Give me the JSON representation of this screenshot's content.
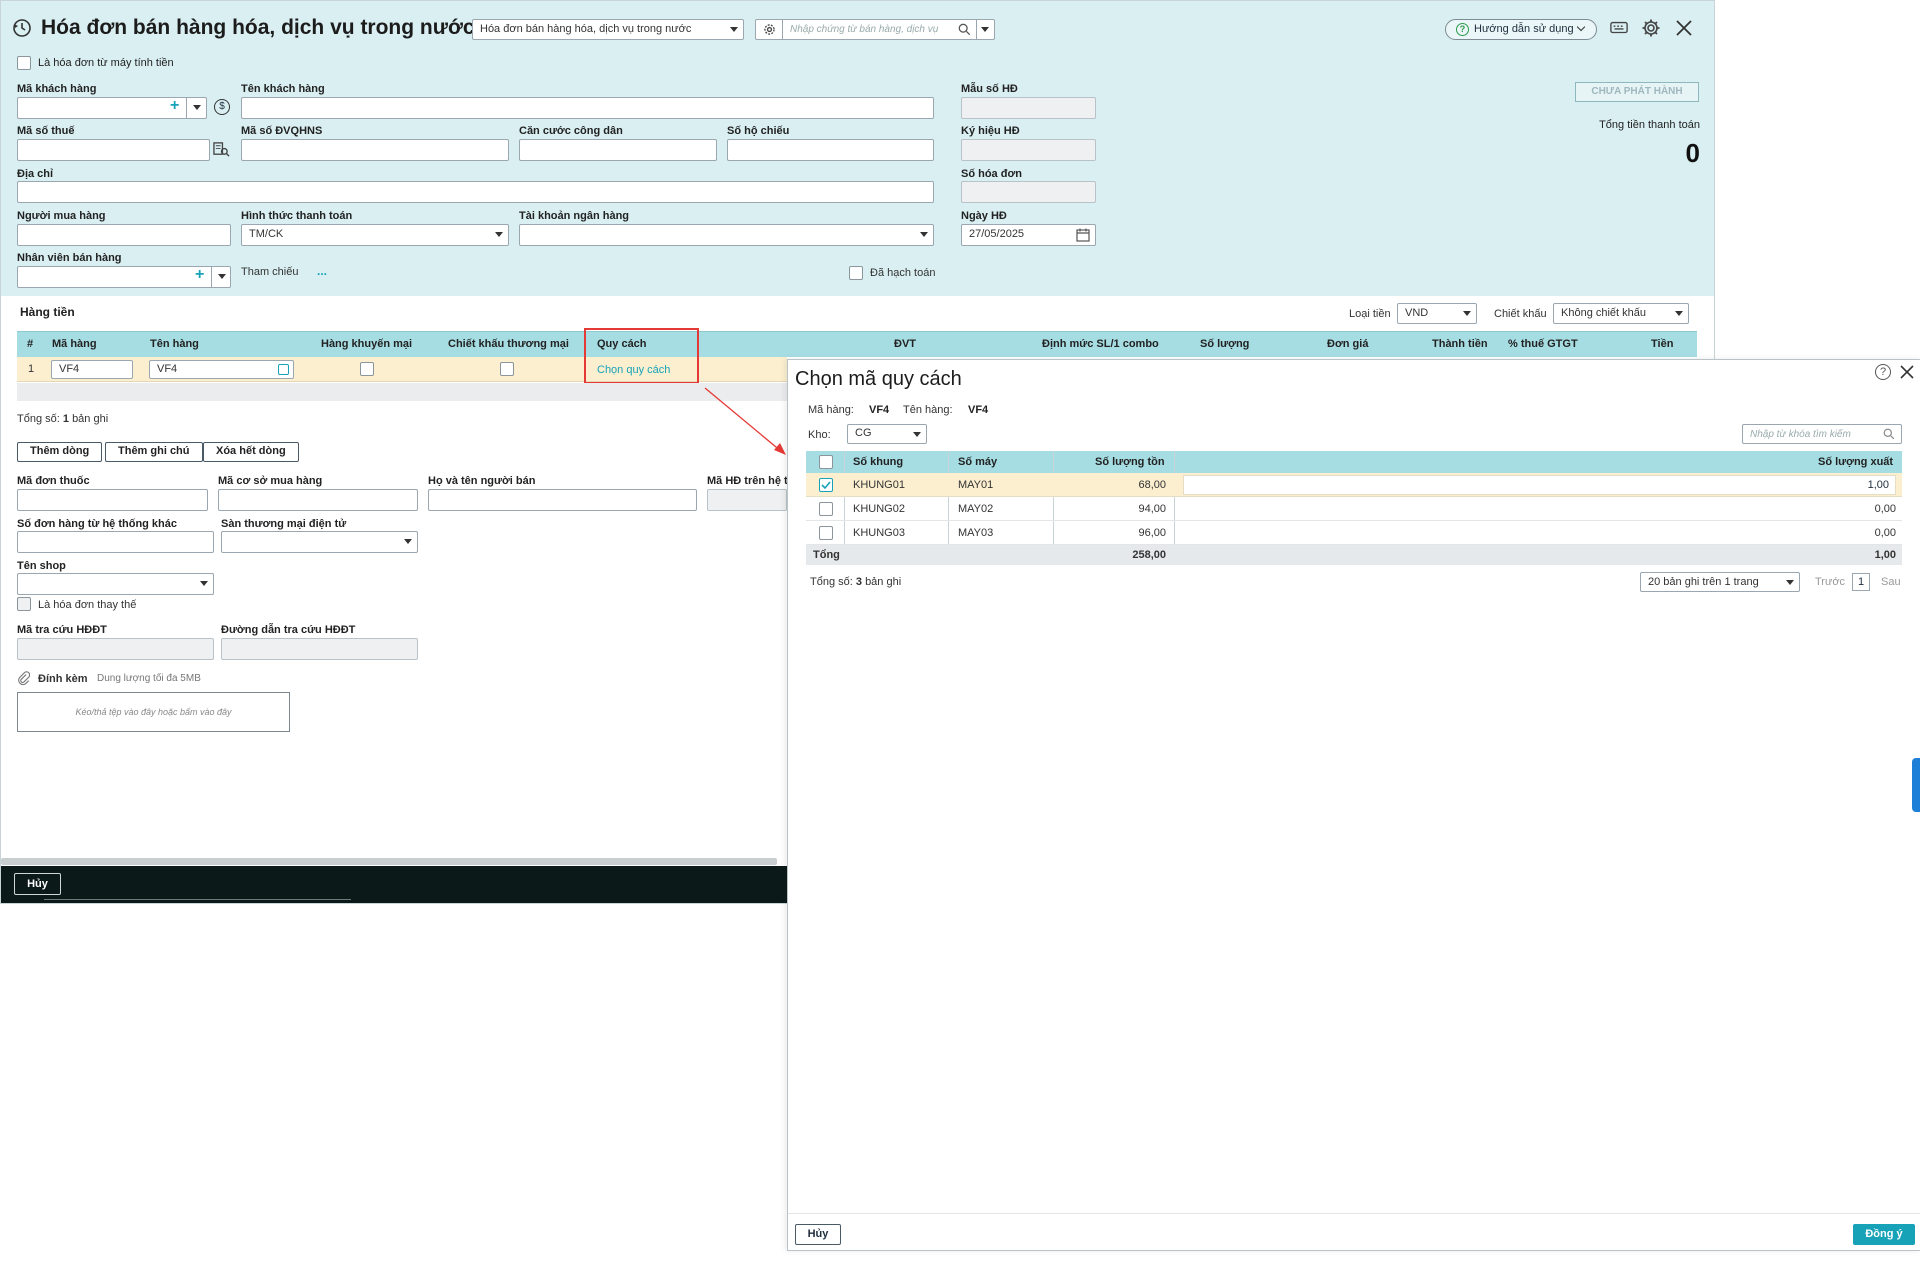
{
  "header": {
    "title": "Hóa đơn bán hàng hóa, dịch vụ trong nước",
    "type_select": "Hóa đơn bán hàng hóa, dịch vụ trong nước",
    "search_placeholder": "Nhập chứng từ bán hàng, dịch vụ",
    "help_label": "Hướng dẫn sử dụng"
  },
  "form": {
    "from_cash_register": "Là hóa đơn từ máy tính tiền",
    "customer_code_label": "Mã khách hàng",
    "customer_name_label": "Tên khách hàng",
    "tax_code_label": "Mã số thuế",
    "budget_code_label": "Mã số ĐVQHNS",
    "citizen_id_label": "Căn cước công dân",
    "passport_label": "Số hộ chiếu",
    "address_label": "Địa chỉ",
    "buyer_label": "Người mua hàng",
    "payment_label": "Hình thức thanh toán",
    "payment_value": "TM/CK",
    "bank_label": "Tài khoản ngân hàng",
    "sales_staff_label": "Nhân viên bán hàng",
    "reference_label": "Tham chiếu",
    "reference_more": "...",
    "posted_label": "Đã hạch toán",
    "form_no_label": "Mẫu số HĐ",
    "symbol_label": "Ký hiệu HĐ",
    "invoice_no_label": "Số hóa đơn",
    "invoice_date_label": "Ngày HĐ",
    "invoice_date_value": "27/05/2025",
    "status_badge": "CHƯA PHÁT HÀNH",
    "total_label": "Tổng tiền thanh toán",
    "total_value": "0"
  },
  "goods": {
    "section_title": "Hàng tiền",
    "currency_label": "Loại tiền",
    "currency_value": "VND",
    "discount_label": "Chiết khấu",
    "discount_value": "Không chiết khấu",
    "columns": [
      "#",
      "Mã hàng",
      "Tên hàng",
      "Hàng khuyến mại",
      "Chiết khấu thương mại",
      "Quy cách",
      "ĐVT",
      "Định mức SL/1 combo",
      "Số lượng",
      "Đơn giá",
      "Thành tiền",
      "% thuế GTGT",
      "Tiền"
    ],
    "row": {
      "index": "1",
      "code": "VF4",
      "name": "VF4",
      "spec_link": "Chọn quy cách"
    },
    "total_prefix": "Tổng số:",
    "total_count": "1",
    "total_suffix": "bản ghi",
    "add_row": "Thêm dòng",
    "add_note": "Thêm ghi chú",
    "delete_all": "Xóa hết dòng"
  },
  "extra": {
    "prescription_label": "Mã đơn thuốc",
    "pharmacy_label": "Mã cơ sở mua hàng",
    "seller_name_label": "Họ và tên người bán",
    "invoice_on_label": "Mã HĐ trên hệ th",
    "other_order_label": "Số đơn hàng từ hệ thống khác",
    "ecommerce_label": "Sàn thương mại điện tử",
    "shop_label": "Tên shop",
    "replace_label": "Là hóa đơn thay thế",
    "lookup_code_label": "Mã tra cứu HĐĐT",
    "lookup_url_label": "Đường dẫn tra cứu HĐĐT",
    "attach_label": "Đính kèm",
    "attach_hint": "Dung lượng tối đa 5MB",
    "drop_hint": "Kéo/thả tệp vào đây hoặc bấm vào đây"
  },
  "footer": {
    "cancel_label": "Hủy"
  },
  "dialog": {
    "title": "Chọn mã quy cách",
    "item_code_label": "Mã hàng:",
    "item_code_value": "VF4",
    "item_name_label": "Tên hàng:",
    "item_name_value": "VF4",
    "warehouse_label": "Kho:",
    "warehouse_value": "CG",
    "search_placeholder": "Nhập từ khóa tìm kiếm",
    "columns": [
      "Số khung",
      "Số máy",
      "Số lượng tồn",
      "Số lượng xuất"
    ],
    "rows": [
      {
        "frame": "KHUNG01",
        "engine": "MAY01",
        "stock": "68,00",
        "qty": "1,00",
        "checked": true
      },
      {
        "frame": "KHUNG02",
        "engine": "MAY02",
        "stock": "94,00",
        "qty": "0,00",
        "checked": false
      },
      {
        "frame": "KHUNG03",
        "engine": "MAY03",
        "stock": "96,00",
        "qty": "0,00",
        "checked": false
      }
    ],
    "total_label": "Tổng",
    "total_stock": "258,00",
    "total_qty": "1,00",
    "count_prefix": "Tổng số:",
    "count_value": "3",
    "count_suffix": "bản ghi",
    "page_size": "20 bản ghi trên 1 trang",
    "prev_label": "Trước",
    "page_number": "1",
    "next_label": "Sau",
    "cancel_label": "Hủy",
    "ok_label": "Đồng ý"
  },
  "colors": {
    "form_bg": "#d9eff2",
    "table_header": "#a6dde3",
    "selected_row": "#fbefd0",
    "accent": "#17a2b8",
    "highlight": "#e53935",
    "footer_bar": "#0b1a18"
  }
}
